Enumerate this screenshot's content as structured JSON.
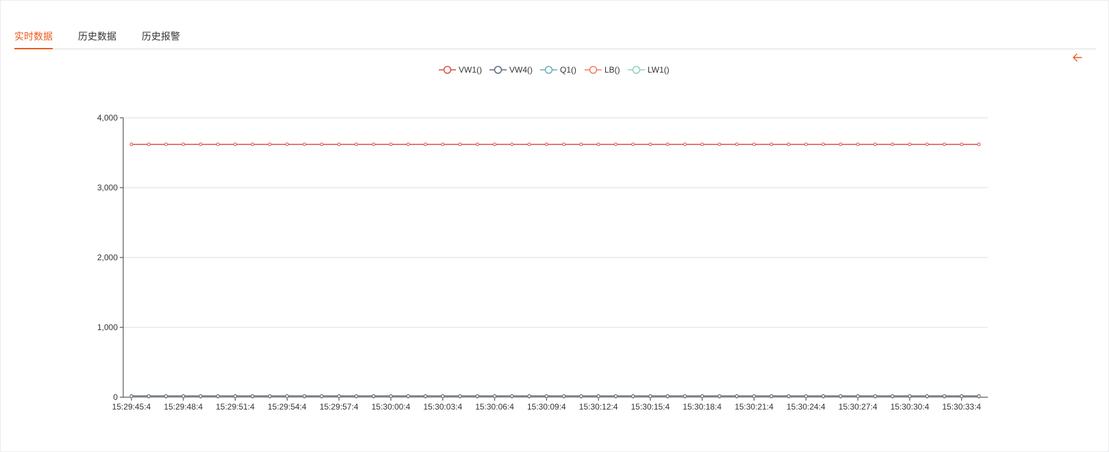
{
  "tabs": [
    {
      "label": "实时数据",
      "active": true
    },
    {
      "label": "历史数据",
      "active": false
    },
    {
      "label": "历史报警",
      "active": false
    }
  ],
  "back_icon": "arrow-left-icon",
  "colors": {
    "accent": "#ec5a1d",
    "series": [
      "#d94e4a",
      "#5b6a82",
      "#6fa9b8",
      "#ef7e5c",
      "#8ed0c0"
    ]
  },
  "chart_data": {
    "type": "line",
    "title": "",
    "xlabel": "",
    "ylabel": "",
    "ylim": [
      0,
      4000
    ],
    "yticks": [
      "0",
      "1,000",
      "2,000",
      "3,000",
      "4,000"
    ],
    "x_tick_labels": [
      "15:29:45:4",
      "15:29:48:4",
      "15:29:51:4",
      "15:29:54:4",
      "15:29:57:4",
      "15:30:00:4",
      "15:30:03:4",
      "15:30:06:4",
      "15:30:09:4",
      "15:30:12:4",
      "15:30:15:4",
      "15:30:18:4",
      "15:30:21:4",
      "15:30:24:4",
      "15:30:27:4",
      "15:30:30:4",
      "15:30:33:4"
    ],
    "num_points": 50,
    "grid": true,
    "legend_position": "top-center",
    "series": [
      {
        "name": "VW1()",
        "value": 3620
      },
      {
        "name": "VW4()",
        "value": 15
      },
      {
        "name": "Q1()",
        "value": 20
      },
      {
        "name": "LB()",
        "value": 10
      },
      {
        "name": "LW1()",
        "value": 5
      }
    ]
  }
}
